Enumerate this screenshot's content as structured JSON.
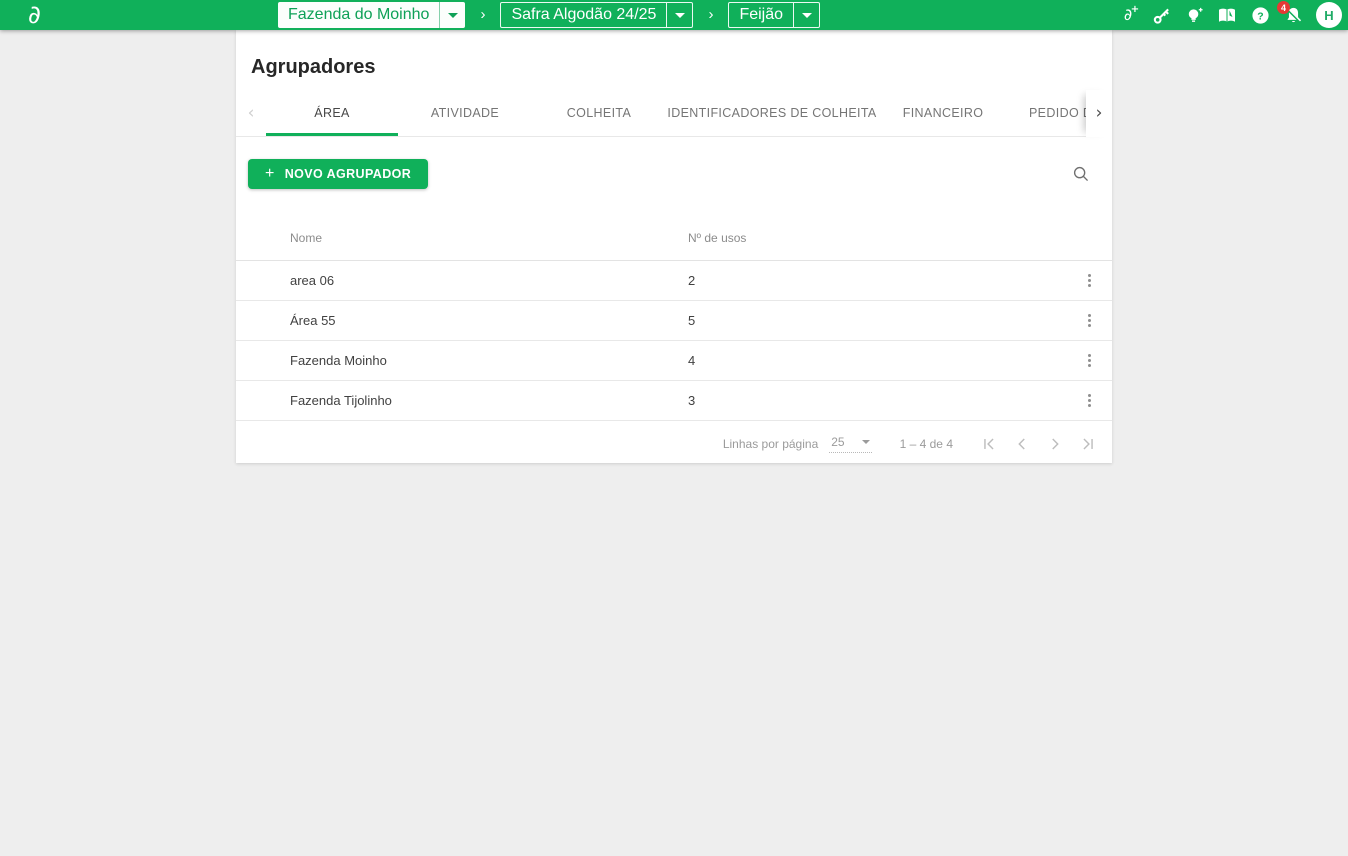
{
  "colors": {
    "brand_green": "#10b05a",
    "badge_red": "#e53935",
    "card_bg": "#ffffff",
    "page_bg": "#eeeeee"
  },
  "app_bar": {
    "breadcrumbs": [
      {
        "label": "Fazenda do Moinho"
      },
      {
        "label": "Safra Algodão 24/25"
      },
      {
        "label": "Feijão"
      }
    ],
    "separator": "›",
    "notification_count": "4",
    "avatar_initial": "H"
  },
  "page": {
    "title": "Agrupadores",
    "tabs": [
      {
        "label": "ÁREA",
        "active": true
      },
      {
        "label": "ATIVIDADE",
        "active": false
      },
      {
        "label": "COLHEITA",
        "active": false
      },
      {
        "label": "IDENTIFICADORES DE COLHEITA",
        "active": false
      },
      {
        "label": "FINANCEIRO",
        "active": false
      },
      {
        "label": "PEDIDO D",
        "active": false
      }
    ],
    "toolbar": {
      "new_button_plus": "+",
      "new_button_label": "NOVO AGRUPADOR"
    },
    "table": {
      "columns": {
        "name": "Nome",
        "uses": "Nº de usos"
      },
      "rows": [
        {
          "nome": "area 06",
          "usos": "2"
        },
        {
          "nome": "Área 55",
          "usos": "5"
        },
        {
          "nome": "Fazenda Moinho",
          "usos": "4"
        },
        {
          "nome": "Fazenda Tijolinho",
          "usos": "3"
        }
      ]
    },
    "pagination": {
      "rows_per_page_label": "Linhas por página",
      "rows_per_page_value": "25",
      "range_label": "1 – 4 de 4"
    }
  }
}
